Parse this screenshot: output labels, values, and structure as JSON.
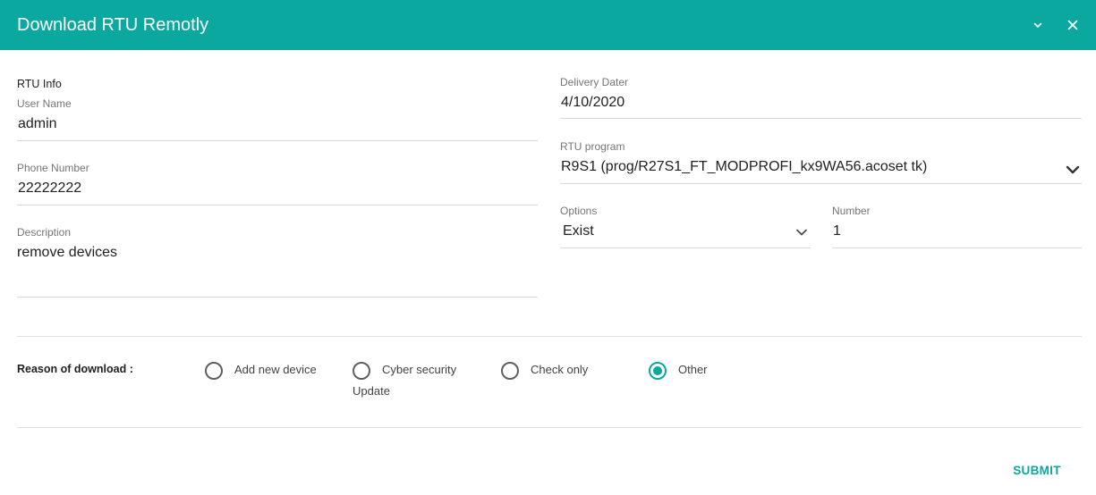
{
  "dialog": {
    "title": "Download RTU Remotly",
    "minimize_icon": "chevron-down-icon",
    "close_icon": "close-icon"
  },
  "form": {
    "section_label": "RTU Info",
    "user_name": {
      "label": "User Name",
      "value": "admin"
    },
    "phone_number": {
      "label": "Phone Number",
      "value": "22222222"
    },
    "description": {
      "label": "Description",
      "value": "remove devices"
    },
    "delivery_date": {
      "label": "Delivery Dater",
      "value": "4/10/2020"
    },
    "rtu_program": {
      "label": "RTU program",
      "value": "R9S1 (prog/R27S1_FT_MODPROFI_kx9WA56.acoset tk)"
    },
    "options": {
      "label": "Options",
      "value": "Exist"
    },
    "number": {
      "label": "Number",
      "value": "1"
    }
  },
  "reason": {
    "label": "Reason of download :",
    "options": [
      {
        "line1": "Add new device",
        "line2": "",
        "checked": false
      },
      {
        "line1": "Cyber security",
        "line2": "Update",
        "checked": false
      },
      {
        "line1": "Check only",
        "line2": "",
        "checked": false
      },
      {
        "line1": "Other",
        "line2": "",
        "checked": true
      }
    ]
  },
  "actions": {
    "submit_label": "SUBMIT"
  },
  "colors": {
    "accent": "#0aa89e",
    "text": "#212121",
    "muted": "#757575"
  }
}
